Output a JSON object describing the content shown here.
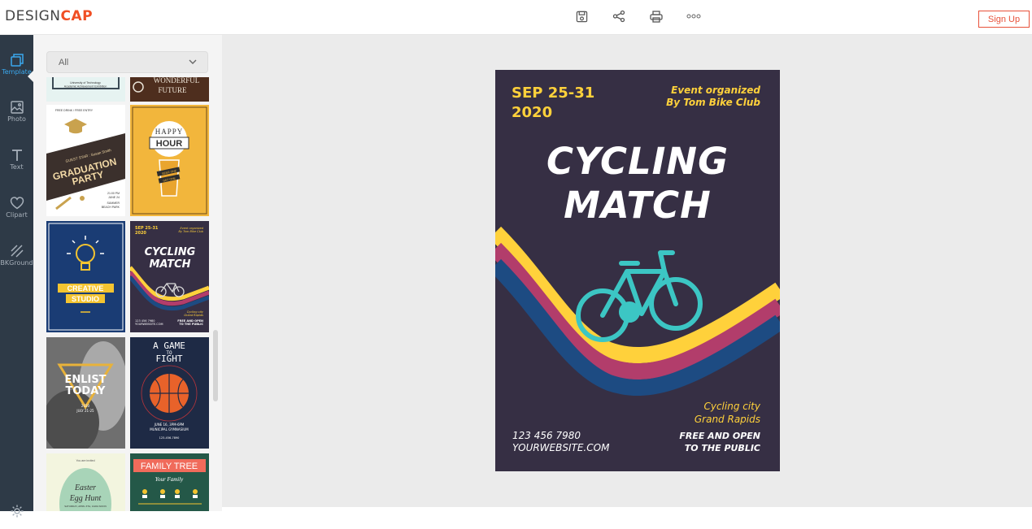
{
  "app": {
    "logo_part1": "DESIGN",
    "logo_part2": "CAP",
    "signup_label": "Sign Up",
    "toolbar": [
      "save-icon",
      "share-icon",
      "print-icon",
      "more-icon"
    ]
  },
  "rail": {
    "items": [
      {
        "label": "Template",
        "icon": "template-icon",
        "active": true
      },
      {
        "label": "Photo",
        "icon": "photo-icon"
      },
      {
        "label": "Text",
        "icon": "text-icon"
      },
      {
        "label": "Clipart",
        "icon": "clipart-icon"
      },
      {
        "label": "BKGround",
        "icon": "background-icon"
      },
      {
        "label": "",
        "icon": "settings-icon"
      }
    ]
  },
  "panel": {
    "filter_value": "All",
    "thumbnails": [
      {
        "name": "thumb-graduation-exhibition",
        "lines": [
          "University of Technology",
          "Academic Achievement Exhibition"
        ]
      },
      {
        "name": "thumb-wonderful-future",
        "lines": [
          "WONDERFUL",
          "FUTURE"
        ]
      },
      {
        "name": "thumb-graduation-party",
        "lines": [
          "FREE DRINK / FREE ENTRY",
          "GUEST STAR : Susan Smith",
          "GRADUATION",
          "PARTY",
          "21:00 PM",
          "JUNE 24",
          "SUMMER",
          "BEACH PARK"
        ]
      },
      {
        "name": "thumb-happy-hour",
        "lines": [
          "HAPPY",
          "HOUR",
          "BEER ONE",
          "GET ONE"
        ]
      },
      {
        "name": "thumb-creative-studio",
        "lines": [
          "CREATIVE",
          "STUDIO"
        ]
      },
      {
        "name": "thumb-cycling-match",
        "lines": [
          "SEP 25-31",
          "2020",
          "Event organized",
          "By Tom Bike Club",
          "CYCLING",
          "MATCH",
          "Cycling city",
          "Grand Rapids",
          "123 456 7980",
          "YOURWEBSITE.COM",
          "FREE AND OPEN",
          "TO THE PUBLIC"
        ]
      },
      {
        "name": "thumb-enlist-today",
        "lines": [
          "ENLIST",
          "TODAY",
          "2020",
          "JULY 21-25"
        ]
      },
      {
        "name": "thumb-a-game-to-fight",
        "lines": [
          "A GAME",
          "TO",
          "FIGHT",
          "JUNE 16, 3PM-6PM",
          "MUNICIPAL GYMNASIUM",
          "123-456-7890"
        ]
      },
      {
        "name": "thumb-easter-egg-hunt",
        "lines": [
          "You are invited",
          "Easter",
          "Egg Hunt",
          "SATURDAY, APRIL 6TH, 10AM-NOON"
        ]
      },
      {
        "name": "thumb-family-tree",
        "lines": [
          "FAMILY TREE",
          "Your Family"
        ]
      }
    ]
  },
  "poster": {
    "date_line1": "SEP 25-31",
    "date_line2": "2020",
    "org_line1": "Event organized",
    "org_line2": "By Tom Bike Club",
    "title_line1": "CYCLING",
    "title_line2": "MATCH",
    "city_line1": "Cycling city",
    "city_line2": "Grand Rapids",
    "phone": "123 456 7980",
    "website": "YOURWEBSITE.COM",
    "free_line1": "FREE AND OPEN",
    "free_line2": "TO THE PUBLIC",
    "colors": {
      "background": "#362f44",
      "yellow": "#ffd13b",
      "pink": "#b23d6b",
      "blue": "#1d4b82",
      "bike": "#3cc6c4"
    }
  }
}
